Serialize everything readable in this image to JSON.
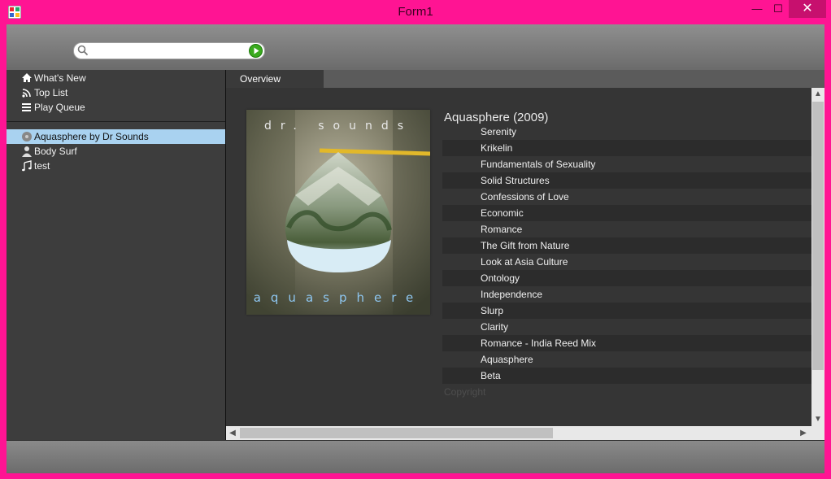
{
  "window": {
    "title": "Form1",
    "minimize_glyph": "—",
    "maximize_glyph": "☐",
    "close_glyph": "✕"
  },
  "search": {
    "value": "",
    "placeholder": ""
  },
  "nav": [
    {
      "label": "What's New",
      "icon": "home-icon"
    },
    {
      "label": "Top List",
      "icon": "signal-icon"
    },
    {
      "label": "Play Queue",
      "icon": "list-icon"
    }
  ],
  "playlists": [
    {
      "label": "Aquasphere by Dr Sounds",
      "icon": "album-disc-icon",
      "selected": true
    },
    {
      "label": "Body Surf",
      "icon": "user-icon",
      "selected": false
    },
    {
      "label": "test",
      "icon": "music-note-icon",
      "selected": false
    }
  ],
  "tabs": {
    "overview": "Overview"
  },
  "album": {
    "title": "Aquasphere (2009)",
    "cover_top_text": "dr. sounds",
    "cover_bottom_text": "aquasphere",
    "copyright": "Copyright",
    "tracks": [
      "Serenity",
      "Krikelin",
      "Fundamentals of Sexuality",
      "Solid Structures",
      "Confessions of Love",
      "Economic",
      "Romance",
      "The Gift from Nature",
      "Look at Asia Culture",
      "Ontology",
      "Independence",
      "Slurp",
      "Clarity",
      "Romance - India Reed Mix",
      "Aquasphere",
      "Beta"
    ]
  },
  "colors": {
    "window_frame": "#ff1493",
    "selection": "#a9d2f0",
    "panel": "#3d3d3d",
    "go_button": "#3aaa1e"
  }
}
